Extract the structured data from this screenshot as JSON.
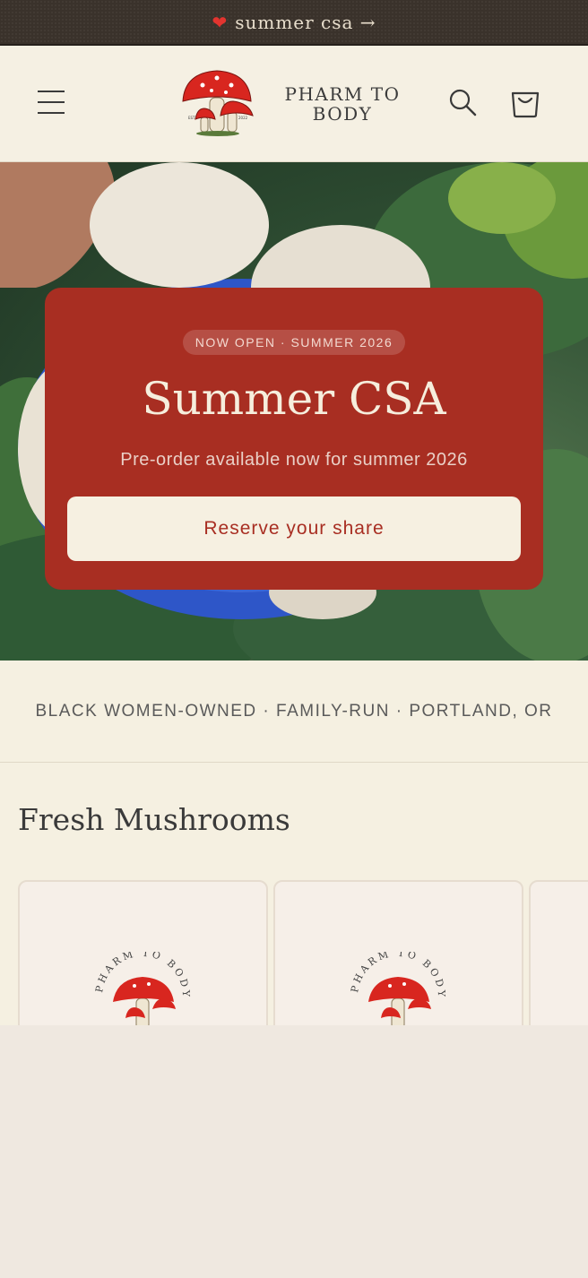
{
  "announcement": {
    "text": "summer csa →"
  },
  "header": {
    "brand_line1": "PHARM TO",
    "brand_line2": "BODY",
    "logo_ring_text": "PHARM TO BODY",
    "logo_est": "EST",
    "logo_year": "2022"
  },
  "hero": {
    "badge": "NOW OPEN · SUMMER 2026",
    "title": "Summer CSA",
    "subtitle": "Pre-order available now for summer 2026",
    "cta": "Reserve your share"
  },
  "tagline": "BLACK WOMEN-OWNED · FAMILY-RUN · PORTLAND, OR",
  "products": {
    "heading": "Fresh Mushrooms"
  },
  "colors": {
    "accent_red": "#a82e22",
    "cream": "#f5f0e1",
    "dark_bar": "#3a322b"
  },
  "icons": [
    "heart-icon",
    "menu-icon",
    "search-icon",
    "cart-icon",
    "mushroom-logo-icon"
  ]
}
